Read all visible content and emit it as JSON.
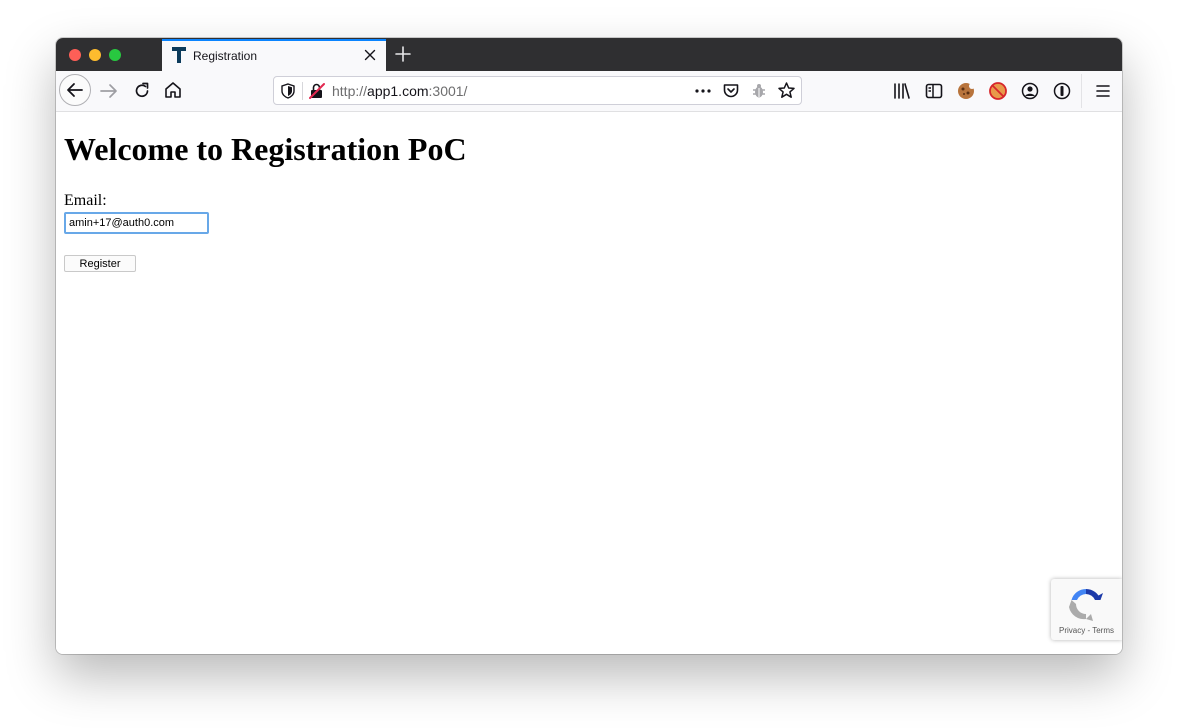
{
  "browser": {
    "tab": {
      "title": "Registration",
      "favicon": "T"
    },
    "url": {
      "scheme": "http://",
      "host": "app1.com",
      "rest": ":3001/"
    },
    "accent_color": "#0a84ff"
  },
  "page": {
    "heading": "Welcome to Registration PoC",
    "email_label": "Email:",
    "email_value": "amin+17@auth0.com",
    "register_label": "Register"
  },
  "recaptcha": {
    "privacy": "Privacy",
    "separator": " - ",
    "terms": "Terms"
  }
}
